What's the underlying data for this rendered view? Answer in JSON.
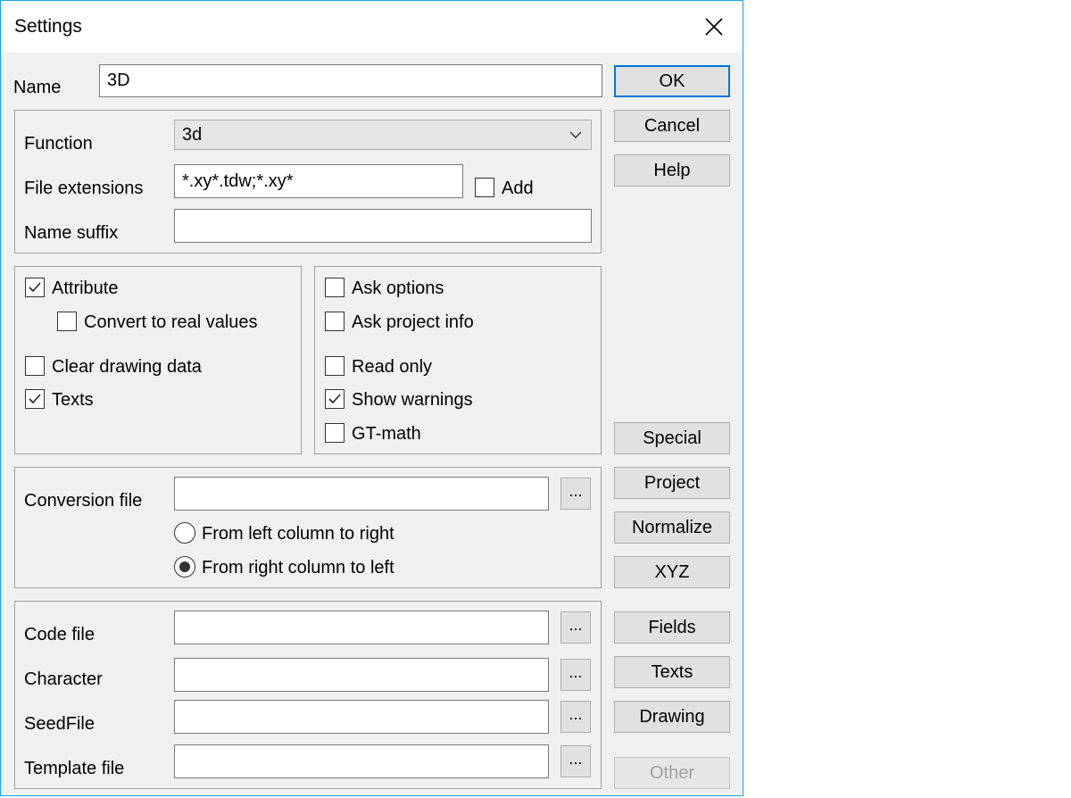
{
  "window": {
    "title": "Settings",
    "close_icon": "close-icon"
  },
  "name": {
    "label": "Name",
    "value": "3D"
  },
  "function": {
    "label": "Function",
    "value": "3d"
  },
  "file_extensions": {
    "label": "File extensions",
    "value": "*.xy*.tdw;*.xy*",
    "add_label": "Add",
    "add_checked": false
  },
  "name_suffix": {
    "label": "Name suffix",
    "value": ""
  },
  "options_left": [
    {
      "label": "Attribute",
      "checked": true
    },
    {
      "label": "Convert to real values",
      "checked": false
    },
    {
      "label": "Clear drawing data",
      "checked": false
    },
    {
      "label": "Texts",
      "checked": true
    }
  ],
  "options_right": [
    {
      "label": "Ask options",
      "checked": false
    },
    {
      "label": "Ask project info",
      "checked": false
    },
    {
      "label": "Read only",
      "checked": false
    },
    {
      "label": "Show warnings",
      "checked": true
    },
    {
      "label": "GT-math",
      "checked": false
    }
  ],
  "conversion": {
    "label": "Conversion file",
    "value": "",
    "browse_label": "...",
    "radios": [
      {
        "label": "From left column to right",
        "selected": false
      },
      {
        "label": "From right column to left",
        "selected": true
      }
    ]
  },
  "files": [
    {
      "label": "Code file",
      "value": "",
      "browse_label": "..."
    },
    {
      "label": "Character",
      "value": "",
      "browse_label": "..."
    },
    {
      "label": "SeedFile",
      "value": "",
      "browse_label": "..."
    },
    {
      "label": "Template file",
      "value": "",
      "browse_label": "..."
    }
  ],
  "buttons": {
    "ok": "OK",
    "cancel": "Cancel",
    "help": "Help",
    "special": "Special",
    "project": "Project",
    "normalize": "Normalize",
    "xyz": "XYZ",
    "fields": "Fields",
    "texts": "Texts",
    "drawing": "Drawing",
    "other": "Other"
  },
  "colors": {
    "accent": "#0078d7",
    "window_border": "#1ba1e2",
    "dialog_bg": "#f0f0f0"
  }
}
